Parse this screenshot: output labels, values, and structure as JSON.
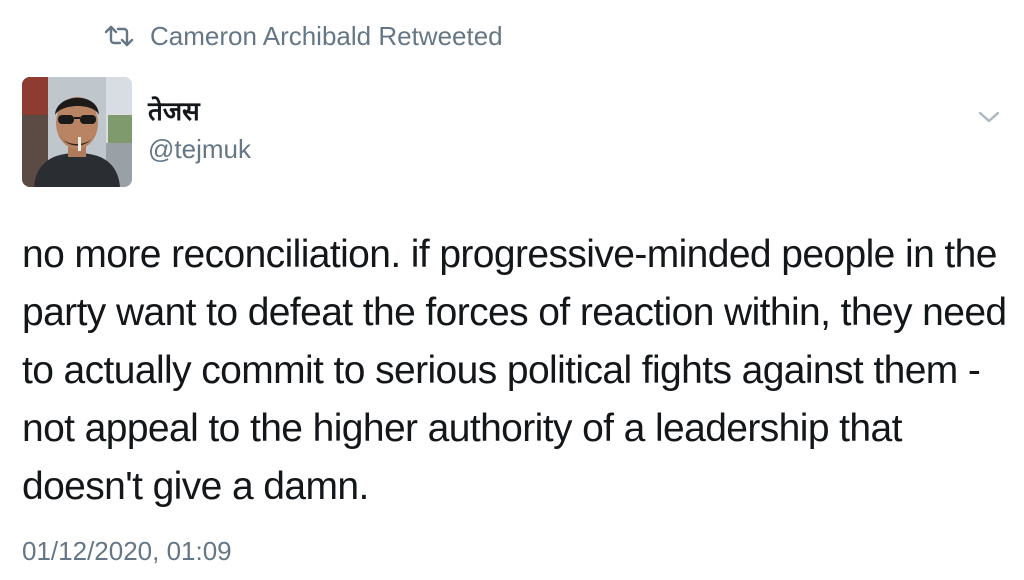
{
  "retweet": {
    "icon": "retweet-icon",
    "label": "Cameron Archibald Retweeted"
  },
  "author": {
    "avatar_icon": "profile-photo",
    "name": "तेजस",
    "handle": "@tejmuk"
  },
  "menu": {
    "icon": "chevron-down-icon"
  },
  "tweet": {
    "text": "no more reconciliation. if progressive-minded people in the party want to defeat the forces of reaction within, they need to actually commit to serious political fights against them - not appeal to the higher authority of a leadership that doesn't give a damn.",
    "timestamp": "01/12/2020, 01:09"
  },
  "colors": {
    "text_primary": "#14171a",
    "text_secondary": "#657786",
    "background": "#ffffff"
  }
}
